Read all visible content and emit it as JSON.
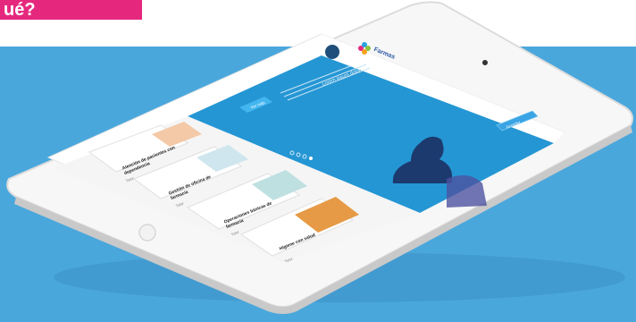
{
  "banner": {
    "tag_text": "ué?"
  },
  "site": {
    "logo_text": "Farmas",
    "menu_icon": "menu-icon"
  },
  "hero": {
    "title": "Lorem ipsum dolor",
    "text": "Lorem ipsum dolor sit amet, consectetur adipiscing elit. Sed do eiusmod tempor incididunt ut labore et dolore.",
    "button_left": "Ver más",
    "button_right": "Acceder",
    "slides": 4,
    "active_slide": 4
  },
  "cards": [
    {
      "title": "Atención de pacientes con dependencia",
      "meta": "Tutor"
    },
    {
      "title": "Gestión de oficina de farmacia",
      "meta": "Tutor"
    },
    {
      "title": "Operaciones básicas de farmacia",
      "meta": "Tutor"
    },
    {
      "title": "Higiene con salud",
      "meta": "Tutor"
    }
  ],
  "colors": {
    "blue_background": "#4aa7dc",
    "hero_blue": "#2596d4",
    "pink_tag": "#e5287e"
  }
}
